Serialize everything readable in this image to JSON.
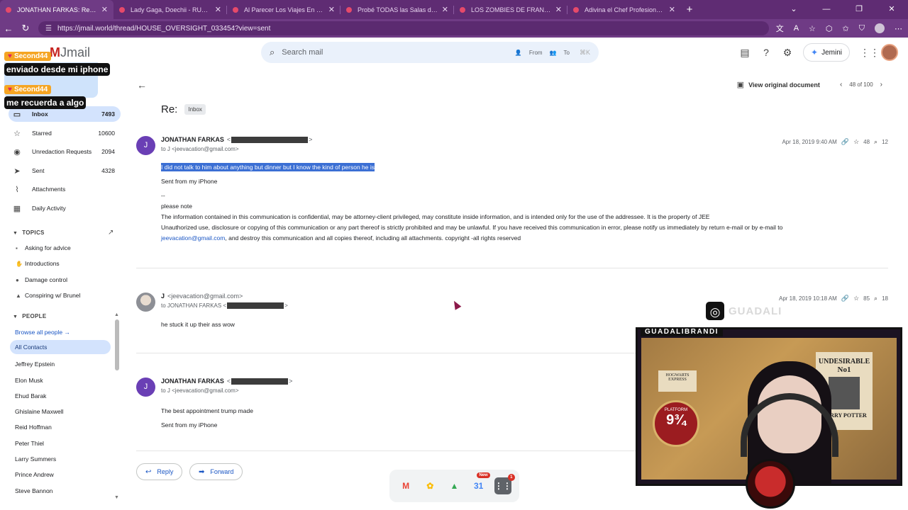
{
  "browser": {
    "tabs": [
      {
        "title": "JONATHAN FARKAS: Re: — Epstein",
        "active": true
      },
      {
        "title": "Lady Gaga, Doechii - RUNWAY (O",
        "active": false
      },
      {
        "title": "Al Parecer Los Viajes En El Tiempo",
        "active": false
      },
      {
        "title": "Probé TODAS las Salas de Cine en",
        "active": false
      },
      {
        "title": "LOS ZOMBIES DE FRANKFURT (JA",
        "active": false
      },
      {
        "title": "Adivina el Chef Profesional - YouT",
        "active": false
      }
    ],
    "url": "https://jmail.world/thread/HOUSE_OVERSIGHT_033454?view=sent",
    "win_controls": [
      "⌄",
      "—",
      "❐",
      "✕"
    ]
  },
  "header": {
    "logo": "Jmail",
    "search_placeholder": "Search mail",
    "filter_from": "From",
    "filter_to": "To",
    "shortcut": "⌘K",
    "gemini_label": "Jemini"
  },
  "overlays": [
    {
      "badge": "Second44",
      "message": "enviado desde mi iphone"
    },
    {
      "badge": "Second44",
      "message": "me recuerda a algo"
    }
  ],
  "sidebar": {
    "items": [
      {
        "label": "Inbox",
        "count": "7493",
        "icon": "inbox-icon",
        "selected": true
      },
      {
        "label": "Starred",
        "count": "10600",
        "icon": "star-icon",
        "selected": false
      },
      {
        "label": "Unredaction Requests",
        "count": "2094",
        "icon": "eye-off-icon",
        "selected": false
      },
      {
        "label": "Sent",
        "count": "4328",
        "icon": "send-icon",
        "selected": false
      },
      {
        "label": "Attachments",
        "count": "",
        "icon": "paperclip-icon",
        "selected": false
      },
      {
        "label": "Daily Activity",
        "count": "",
        "icon": "calendar-icon",
        "selected": false
      }
    ],
    "topics_header": "TOPICS",
    "topics": [
      {
        "label": "Asking for advice",
        "icon": "chat-icon"
      },
      {
        "label": "Introductions",
        "icon": "handshake-icon"
      },
      {
        "label": "Damage control",
        "icon": "shield-icon"
      },
      {
        "label": "Conspiring w/ Brunel",
        "icon": "triangle-icon"
      }
    ],
    "people_header": "PEOPLE",
    "browse_people": "Browse all people →",
    "people": [
      "All Contacts",
      "Jeffrey Epstein",
      "Elon Musk",
      "Ehud Barak",
      "Ghislaine Maxwell",
      "Reid Hoffman",
      "Peter Thiel",
      "Larry Summers",
      "Prince Andrew",
      "Steve Bannon"
    ]
  },
  "thread": {
    "view_original": "View original document",
    "pager": "48 of 100",
    "subject": "Re:",
    "label": "Inbox",
    "messages": [
      {
        "avatar": "J",
        "sender": "JONATHAN FARKAS",
        "to": "to J <jeevacation@gmail.com>",
        "date": "Apr 18, 2019 9:40 AM",
        "stars": "48",
        "views": "12",
        "highlight": "I did not talk to him about anything but dinner but I know the kind of person he is",
        "lines": [
          "Sent from my iPhone",
          "--",
          "please note",
          "The information contained in this communication is confidential, may be attorney-client privileged, may constitute inside information, and is intended only for the use of the addressee. It is the property of JEE",
          "Unauthorized use, disclosure or copying of this communication or any part thereof is strictly prohibited and may be unlawful. If you have received this communication in error, please notify us immediately by return e-mail or by e-mail to"
        ],
        "link": "jeevacation@gmail.com",
        "link_tail": ", and destroy this communication and all copies thereof, including all attachments. copyright -all rights reserved"
      },
      {
        "avatar": "",
        "sender": "J",
        "sender_email": "<jeevacation@gmail.com>",
        "to": "to JONATHAN FARKAS <",
        "date": "Apr 18, 2019 10:18 AM",
        "stars": "85",
        "views": "18",
        "lines": [
          "he stuck it up their ass wow"
        ]
      },
      {
        "avatar": "J",
        "sender": "JONATHAN FARKAS",
        "to": "to J <jeevacation@gmail.com>",
        "lines": [
          "The best appointment trump made",
          "Sent from my iPhone"
        ]
      }
    ],
    "reply_label": "Reply",
    "forward_label": "Forward"
  },
  "dock": {
    "new_badge": "New",
    "calendar_day": "31",
    "apps_count": "1"
  },
  "stream": {
    "instagram_handle": "GUADALI",
    "cam_name": "GUADALIBRANDI",
    "poster_title": "UNDESIRABLE",
    "poster_number": "No1",
    "poster_name": "HARRY POTTER",
    "platform_label": "PLATFORM",
    "platform_number": "9¾",
    "hogwarts": "HOGWARTS EXPRESS"
  }
}
